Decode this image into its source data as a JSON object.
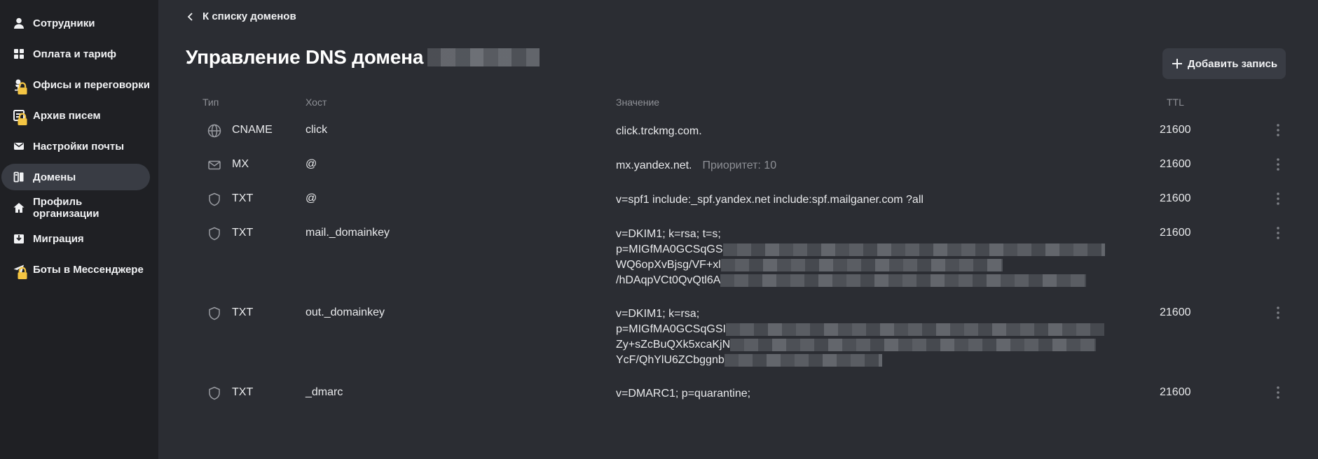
{
  "sidebar": {
    "items": [
      {
        "label": "Сотрудники",
        "icon": "person-icon",
        "locked": false,
        "active": false
      },
      {
        "label": "Оплата и тариф",
        "icon": "grid-icon",
        "locked": false,
        "active": false
      },
      {
        "label": "Офисы и переговорки",
        "icon": "office-icon",
        "locked": true,
        "active": false
      },
      {
        "label": "Архив писем",
        "icon": "archive-icon",
        "locked": true,
        "active": false
      },
      {
        "label": "Настройки почты",
        "icon": "mail-icon",
        "locked": false,
        "active": false
      },
      {
        "label": "Домены",
        "icon": "domains-icon",
        "locked": false,
        "active": true
      },
      {
        "label": "Профиль организации",
        "icon": "home-icon",
        "locked": false,
        "active": false
      },
      {
        "label": "Миграция",
        "icon": "migration-icon",
        "locked": false,
        "active": false
      },
      {
        "label": "Боты в Мессенджере",
        "icon": "bot-icon",
        "locked": true,
        "active": false
      }
    ]
  },
  "header": {
    "back_label": "К списку доменов",
    "title": "Управление DNS домена",
    "add_button_label": "Добавить запись"
  },
  "table": {
    "columns": {
      "type": "Тип",
      "host": "Хост",
      "value": "Значение",
      "ttl": "TTL"
    },
    "rows": [
      {
        "icon": "globe-icon",
        "type": "CNAME",
        "host": "click",
        "value_lines": [
          "click.trckmg.com."
        ],
        "extra": "",
        "ttl": "21600"
      },
      {
        "icon": "envelope-icon",
        "type": "MX",
        "host": "@",
        "value_lines": [
          "mx.yandex.net."
        ],
        "extra": "Приоритет: 10",
        "ttl": "21600"
      },
      {
        "icon": "shield-icon",
        "type": "TXT",
        "host": "@",
        "value_lines": [
          "v=spf1 include:_spf.yandex.net include:spf.mailganer.com ?all"
        ],
        "extra": "",
        "ttl": "21600"
      },
      {
        "icon": "shield-icon",
        "type": "TXT",
        "host": "mail._domainkey",
        "value_lines": [
          "v=DKIM1; k=rsa; t=s;",
          "p=MIGfMA0GCSqGS",
          "WQ6opXvBjsg/VF+xl",
          "/hDAqpVCt0QvQtl6A"
        ],
        "extra": "",
        "ttl": "21600"
      },
      {
        "icon": "shield-icon",
        "type": "TXT",
        "host": "out._domainkey",
        "value_lines": [
          "v=DKIM1; k=rsa;",
          "p=MIGfMA0GCSqGSI",
          "Zy+sZcBuQXk5xcaKjN",
          "YcF/QhYlU6ZCbggnb"
        ],
        "extra": "",
        "ttl": "21600"
      },
      {
        "icon": "shield-icon",
        "type": "TXT",
        "host": "_dmarc",
        "value_lines": [
          "v=DMARC1; p=quarantine;"
        ],
        "extra": "",
        "ttl": "21600"
      }
    ]
  }
}
